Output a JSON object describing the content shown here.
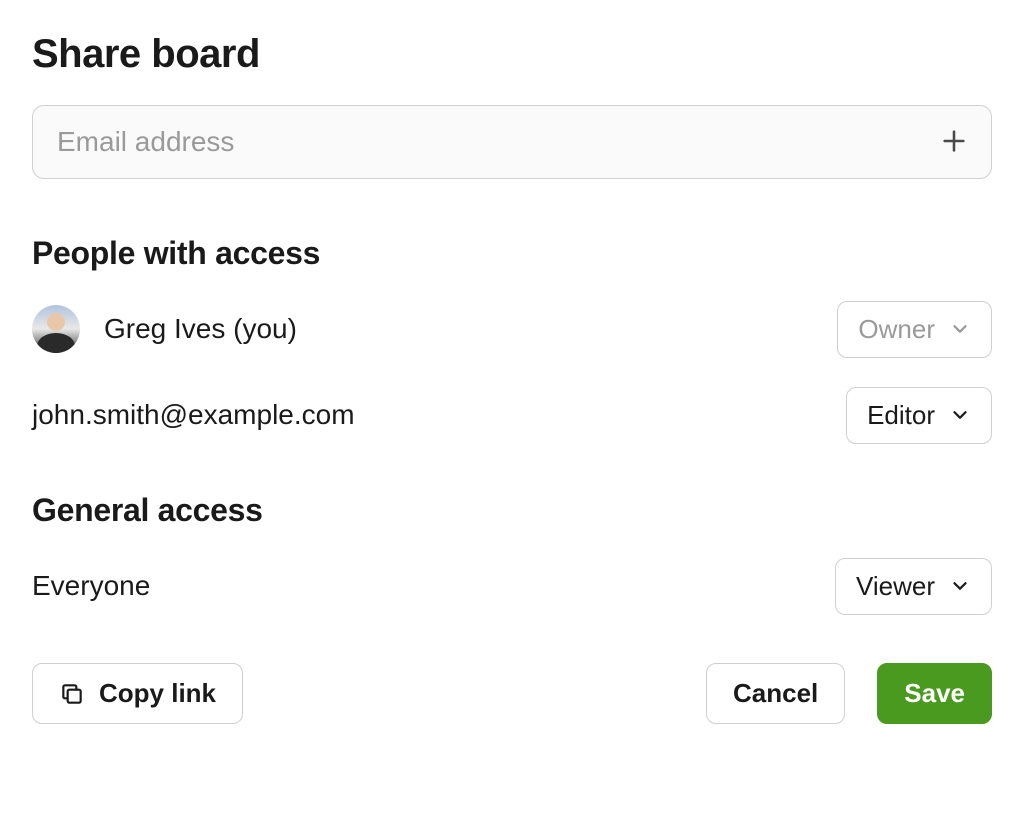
{
  "title": "Share board",
  "email_input": {
    "placeholder": "Email address",
    "value": ""
  },
  "people_section": {
    "title": "People with access",
    "people": [
      {
        "name": "Greg Ives (you)",
        "role": "Owner",
        "has_avatar": true,
        "role_disabled": true
      },
      {
        "name": "john.smith@example.com",
        "role": "Editor",
        "has_avatar": false,
        "role_disabled": false
      }
    ]
  },
  "general_section": {
    "title": "General access",
    "label": "Everyone",
    "role": "Viewer"
  },
  "footer": {
    "copy_link": "Copy link",
    "cancel": "Cancel",
    "save": "Save"
  }
}
